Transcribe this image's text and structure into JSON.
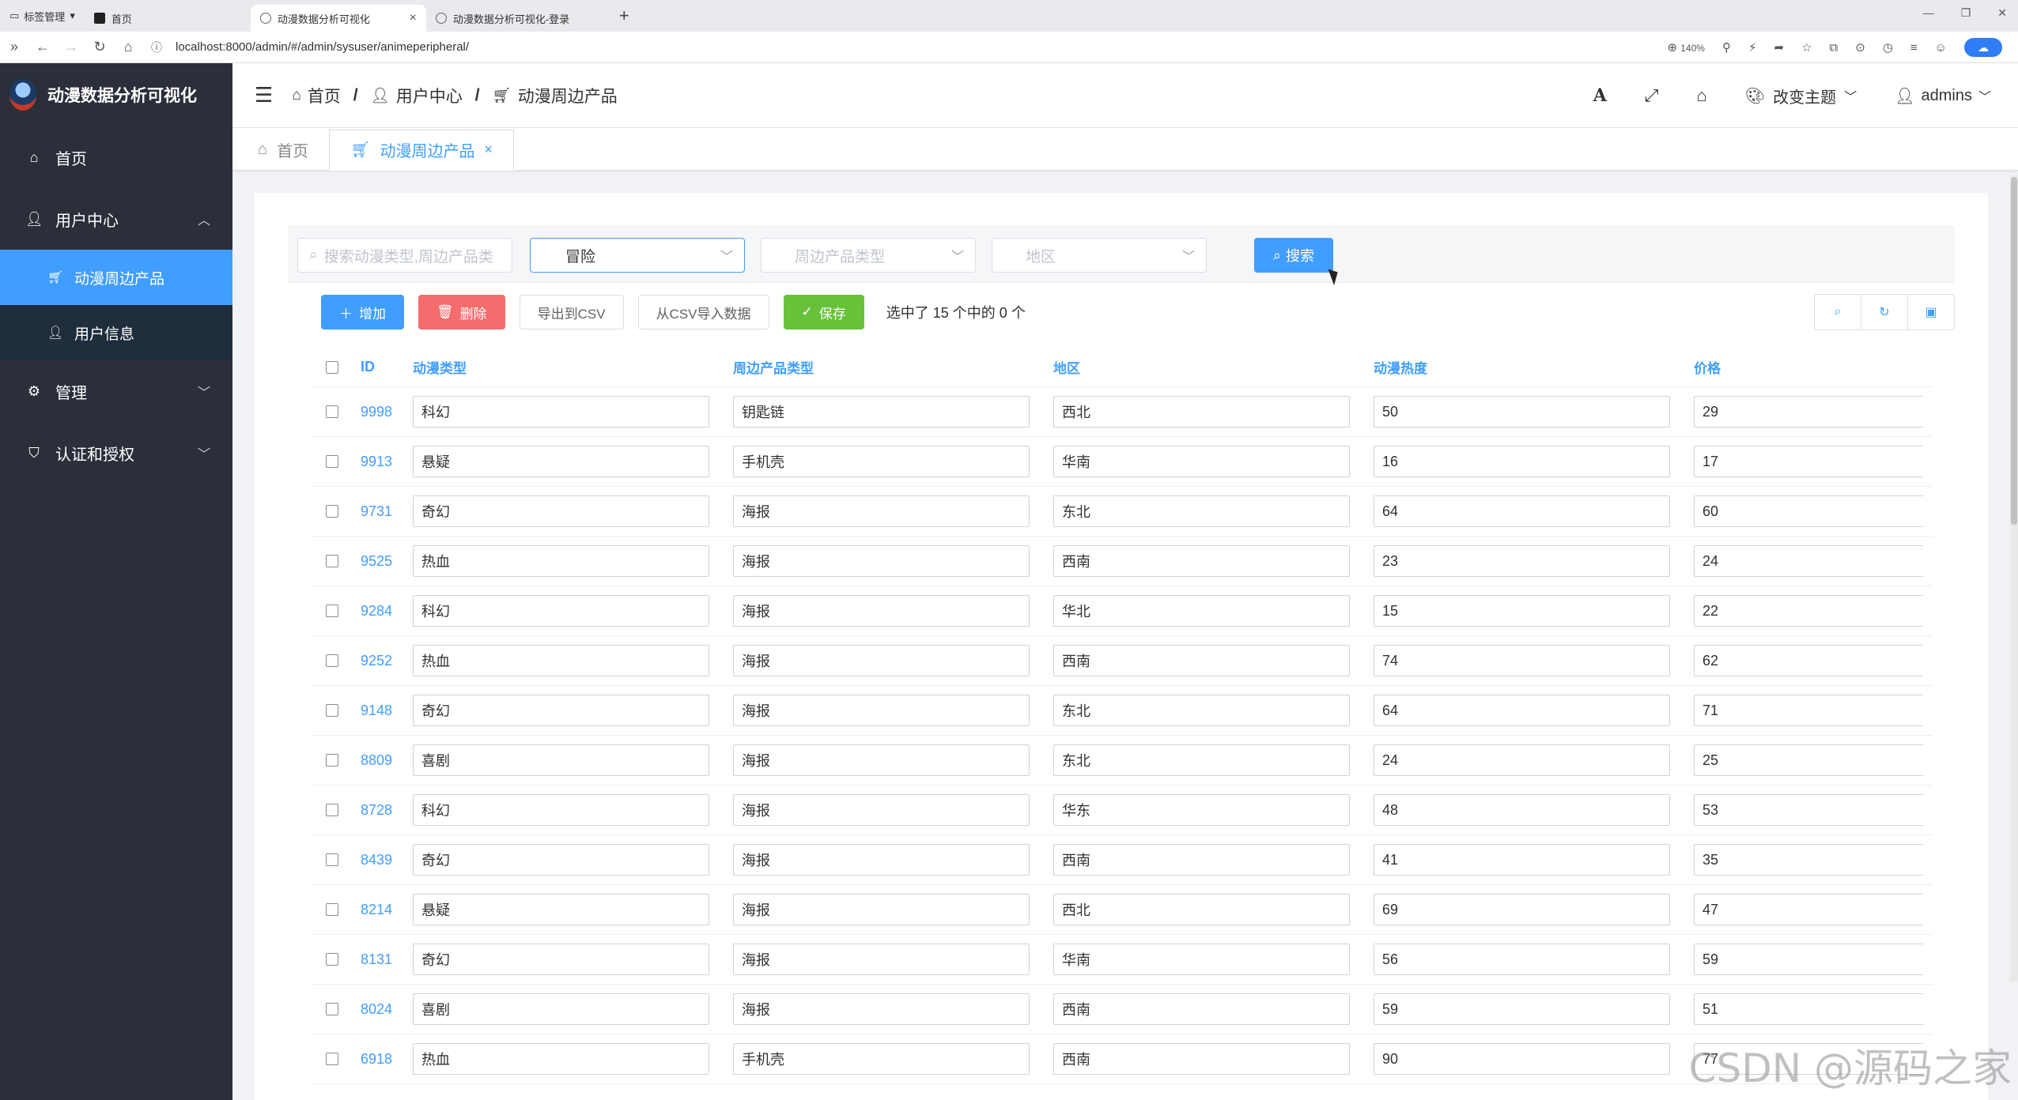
{
  "browser": {
    "tabs": [
      {
        "label": "标签管理"
      },
      {
        "label": "首页"
      },
      {
        "label": "动漫数据分析可视化",
        "active": true
      },
      {
        "label": "动漫数据分析可视化-登录"
      }
    ],
    "url": "localhost:8000/admin/#/admin/sysuser/animeperipheral/",
    "zoom": "140%"
  },
  "sidebar": {
    "brand": "动漫数据分析可视化",
    "menu": [
      {
        "label": "首页",
        "icon": "home-icon"
      },
      {
        "label": "用户中心",
        "icon": "user-icon",
        "expanded": true,
        "children": [
          {
            "label": "动漫周边产品",
            "icon": "cart-icon",
            "active": true
          },
          {
            "label": "用户信息",
            "icon": "user-icon"
          }
        ]
      },
      {
        "label": "管理",
        "icon": "gear-icon"
      },
      {
        "label": "认证和授权",
        "icon": "shield-icon"
      }
    ]
  },
  "navbar": {
    "breadcrumb": [
      "首页",
      "用户中心",
      "动漫周边产品"
    ],
    "theme_label": "改变主题",
    "user": "admins"
  },
  "tagsview": {
    "tabs": [
      {
        "label": "首页",
        "icon": "home-icon"
      },
      {
        "label": "动漫周边产品",
        "icon": "cart-icon",
        "active": true
      }
    ]
  },
  "search": {
    "placeholder": "搜索动漫类型,周边产品类",
    "anime_type_value": "冒险",
    "product_type_placeholder": "周边产品类型",
    "region_placeholder": "地区",
    "search_label": "搜索"
  },
  "toolbar": {
    "add": "增加",
    "delete": "删除",
    "export": "导出到CSV",
    "import": "从CSV导入数据",
    "save": "保存",
    "selection_info": "选中了 15 个中的 0 个"
  },
  "table": {
    "columns": [
      "ID",
      "动漫类型",
      "周边产品类型",
      "地区",
      "动漫热度",
      "价格"
    ],
    "rows": [
      {
        "id": "9998",
        "anime_type": "科幻",
        "product_type": "钥匙链",
        "region": "西北",
        "heat": "50",
        "price": "29"
      },
      {
        "id": "9913",
        "anime_type": "悬疑",
        "product_type": "手机壳",
        "region": "华南",
        "heat": "16",
        "price": "17"
      },
      {
        "id": "9731",
        "anime_type": "奇幻",
        "product_type": "海报",
        "region": "东北",
        "heat": "64",
        "price": "60"
      },
      {
        "id": "9525",
        "anime_type": "热血",
        "product_type": "海报",
        "region": "西南",
        "heat": "23",
        "price": "24"
      },
      {
        "id": "9284",
        "anime_type": "科幻",
        "product_type": "海报",
        "region": "华北",
        "heat": "15",
        "price": "22"
      },
      {
        "id": "9252",
        "anime_type": "热血",
        "product_type": "海报",
        "region": "西南",
        "heat": "74",
        "price": "62"
      },
      {
        "id": "9148",
        "anime_type": "奇幻",
        "product_type": "海报",
        "region": "东北",
        "heat": "64",
        "price": "71"
      },
      {
        "id": "8809",
        "anime_type": "喜剧",
        "product_type": "海报",
        "region": "东北",
        "heat": "24",
        "price": "25"
      },
      {
        "id": "8728",
        "anime_type": "科幻",
        "product_type": "海报",
        "region": "华东",
        "heat": "48",
        "price": "53"
      },
      {
        "id": "8439",
        "anime_type": "奇幻",
        "product_type": "海报",
        "region": "西南",
        "heat": "41",
        "price": "35"
      },
      {
        "id": "8214",
        "anime_type": "悬疑",
        "product_type": "海报",
        "region": "西北",
        "heat": "69",
        "price": "47"
      },
      {
        "id": "8131",
        "anime_type": "奇幻",
        "product_type": "海报",
        "region": "华南",
        "heat": "56",
        "price": "59"
      },
      {
        "id": "8024",
        "anime_type": "喜剧",
        "product_type": "海报",
        "region": "西南",
        "heat": "59",
        "price": "51"
      },
      {
        "id": "6918",
        "anime_type": "热血",
        "product_type": "手机壳",
        "region": "西南",
        "heat": "90",
        "price": "77"
      }
    ]
  },
  "watermark": "CSDN @源码之家",
  "colors": {
    "primary": "#409eff",
    "danger": "#f56c6c",
    "success": "#67c23a",
    "sidebar": "#2b2f3a",
    "sidebar_sub": "#1f2d3d"
  }
}
